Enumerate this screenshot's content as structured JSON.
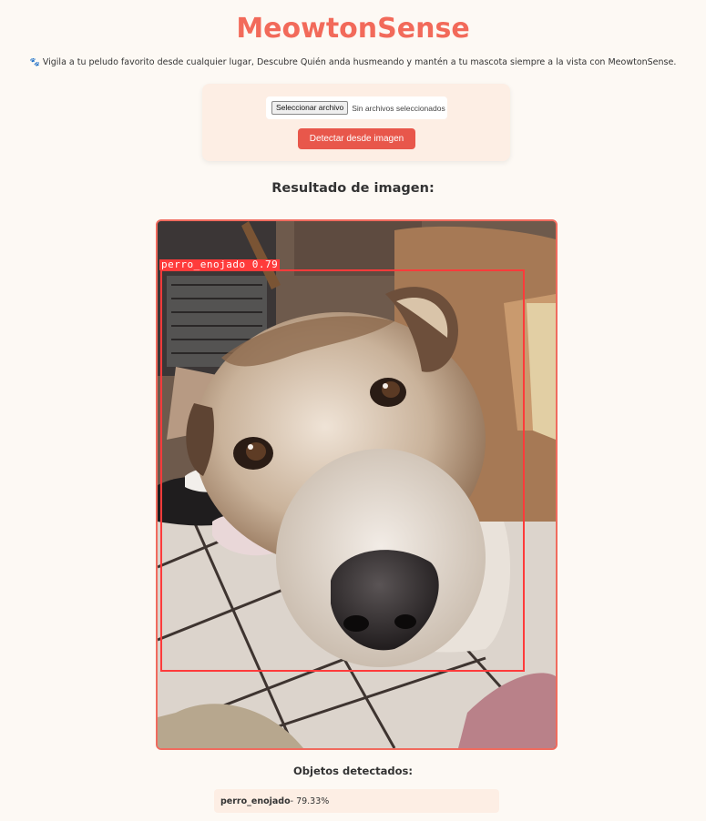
{
  "header": {
    "title": "MeowtonSense",
    "tagline": "Vigila a tu peludo favorito desde cualquier lugar, Descubre Quién anda husmeando y mantén a tu mascota siempre a la vista con MeowtonSense.",
    "tagline_icon": "paw-prints-icon"
  },
  "upload": {
    "file_button_label": "Seleccionar archivo",
    "file_status": "Sin archivos seleccionados",
    "detect_button_label": "Detectar desde imagen"
  },
  "result": {
    "heading": "Resultado de imagen:",
    "detection_label": "perro_enojado 0.79"
  },
  "objects": {
    "heading": "Objetos detectados:",
    "items": [
      {
        "name": "perro_enojado",
        "confidence": " - 79.33%"
      }
    ]
  },
  "colors": {
    "accent": "#f26a5a",
    "button": "#e8574b",
    "card_bg": "#fdeee4",
    "page_bg": "#fdf9f4",
    "detection_box": "#ff3b3b"
  }
}
